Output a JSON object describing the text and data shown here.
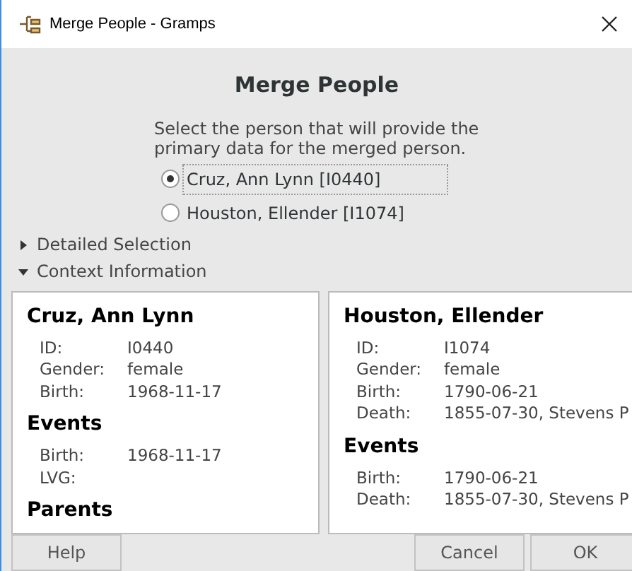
{
  "window": {
    "title": "Merge People - Gramps"
  },
  "heading": "Merge People",
  "instruction": "Select the person that will provide the primary data for the merged person.",
  "choices": [
    {
      "label": "Cruz, Ann Lynn [I0440]",
      "selected": true
    },
    {
      "label": "Houston, Ellender [I1074]",
      "selected": false
    }
  ],
  "expanders": [
    {
      "label": "Detailed Selection",
      "expanded": false
    },
    {
      "label": "Context Information",
      "expanded": true
    }
  ],
  "panels": [
    {
      "name": "Cruz, Ann Lynn",
      "sections": [
        {
          "facts": [
            {
              "label": "ID:",
              "value": "I0440"
            },
            {
              "label": "Gender:",
              "value": "female"
            },
            {
              "label": "Birth:",
              "value": "1968-11-17"
            }
          ]
        },
        {
          "title": "Events",
          "facts": [
            {
              "label": "Birth:",
              "value": "1968-11-17"
            },
            {
              "label": "LVG:"
            }
          ]
        },
        {
          "title": "Parents"
        }
      ]
    },
    {
      "name": "Houston, Ellender",
      "sections": [
        {
          "facts": [
            {
              "label": "ID:",
              "value": "I1074"
            },
            {
              "label": "Gender:",
              "value": "female"
            },
            {
              "label": "Birth:",
              "value": "1790-06-21"
            },
            {
              "label": "Death:",
              "value": "1855-07-30, Stevens P"
            }
          ]
        },
        {
          "title": "Events",
          "facts": [
            {
              "label": "Birth:",
              "value": "1790-06-21"
            },
            {
              "label": "Death:",
              "value": "1855-07-30, Stevens P"
            }
          ]
        }
      ]
    }
  ],
  "buttons": {
    "help": "Help",
    "cancel": "Cancel",
    "ok": "OK"
  }
}
